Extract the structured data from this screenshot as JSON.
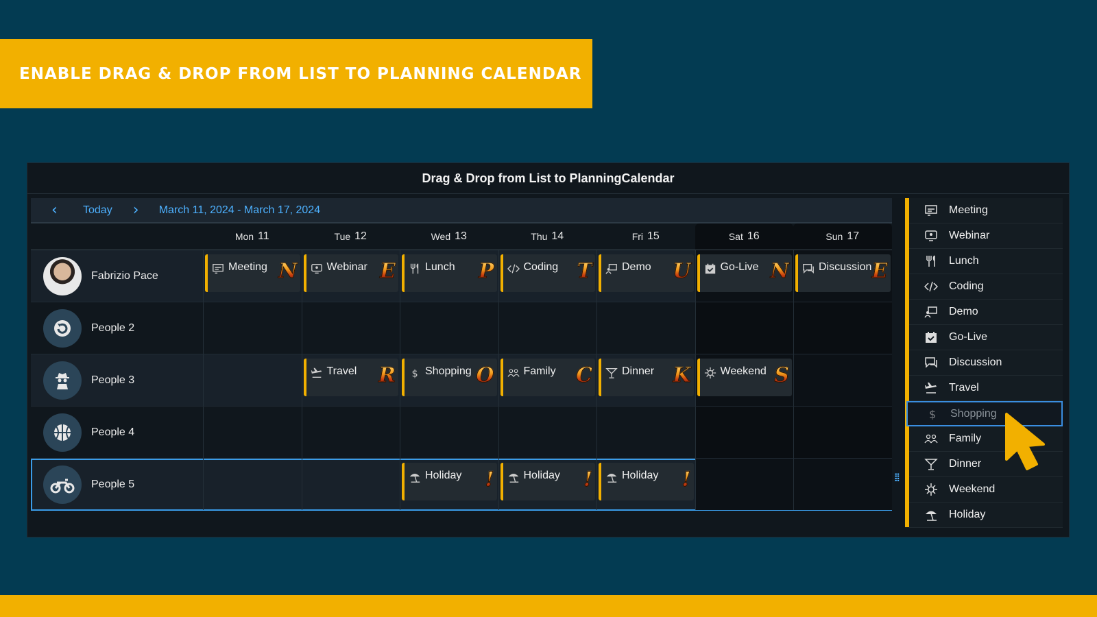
{
  "banner": {
    "text": "ENABLE DRAG & DROP FROM LIST TO PLANNING CALENDAR"
  },
  "app": {
    "title": "Drag & Drop from List to PlanningCalendar"
  },
  "toolbar": {
    "prev_icon": "chevron-left-icon",
    "today_label": "Today",
    "next_icon": "chevron-right-icon",
    "date_range": "March 11, 2024 - March 17, 2024"
  },
  "days": [
    {
      "dow": "Mon",
      "num": "11"
    },
    {
      "dow": "Tue",
      "num": "12"
    },
    {
      "dow": "Wed",
      "num": "13"
    },
    {
      "dow": "Thu",
      "num": "14"
    },
    {
      "dow": "Fri",
      "num": "15"
    },
    {
      "dow": "Sat",
      "num": "16"
    },
    {
      "dow": "Sun",
      "num": "17"
    }
  ],
  "people": [
    {
      "name": "Fabrizio Pace",
      "avatar": "photo"
    },
    {
      "name": "People 2",
      "avatar": "refresh-icon"
    },
    {
      "name": "People 3",
      "avatar": "spy-icon"
    },
    {
      "name": "People 4",
      "avatar": "basketball-icon"
    },
    {
      "name": "People 5",
      "avatar": "motorcycle-icon"
    }
  ],
  "appointments": {
    "row0": [
      {
        "title": "Meeting",
        "icon": "meeting-icon",
        "letter": "N"
      },
      {
        "title": "Webinar",
        "icon": "webinar-icon",
        "letter": "E"
      },
      {
        "title": "Lunch",
        "icon": "lunch-icon",
        "letter": "P"
      },
      {
        "title": "Coding",
        "icon": "coding-icon",
        "letter": "T"
      },
      {
        "title": "Demo",
        "icon": "demo-icon",
        "letter": "U"
      },
      {
        "title": "Go-Live",
        "icon": "go-live-icon",
        "letter": "N"
      },
      {
        "title": "Discussion",
        "icon": "discussion-icon",
        "letter": "E"
      }
    ],
    "row2": [
      {
        "title": "Travel",
        "icon": "travel-icon",
        "letter": "R"
      },
      {
        "title": "Shopping",
        "icon": "shopping-icon",
        "letter": "O"
      },
      {
        "title": "Family",
        "icon": "family-icon",
        "letter": "C"
      },
      {
        "title": "Dinner",
        "icon": "dinner-icon",
        "letter": "K"
      },
      {
        "title": "Weekend",
        "icon": "weekend-icon",
        "letter": "S"
      }
    ],
    "row4": [
      {
        "title": "Holiday",
        "icon": "holiday-icon",
        "letter": "!"
      },
      {
        "title": "Holiday",
        "icon": "holiday-icon",
        "letter": "!"
      },
      {
        "title": "Holiday",
        "icon": "holiday-icon",
        "letter": "!"
      }
    ]
  },
  "list": {
    "items": [
      {
        "label": "Meeting",
        "icon": "meeting-icon"
      },
      {
        "label": "Webinar",
        "icon": "webinar-icon"
      },
      {
        "label": "Lunch",
        "icon": "lunch-icon"
      },
      {
        "label": "Coding",
        "icon": "coding-icon"
      },
      {
        "label": "Demo",
        "icon": "demo-icon"
      },
      {
        "label": "Go-Live",
        "icon": "go-live-icon"
      },
      {
        "label": "Discussion",
        "icon": "discussion-icon"
      },
      {
        "label": "Travel",
        "icon": "travel-icon"
      },
      {
        "label": "Shopping",
        "icon": "shopping-icon",
        "state": "dragging"
      },
      {
        "label": "Family",
        "icon": "family-icon"
      },
      {
        "label": "Dinner",
        "icon": "dinner-icon"
      },
      {
        "label": "Weekend",
        "icon": "weekend-icon"
      },
      {
        "label": "Holiday",
        "icon": "holiday-icon"
      }
    ]
  },
  "colors": {
    "accent": "#f2b000",
    "link": "#4db1ff",
    "background": "#033b52",
    "panel": "#10171d"
  }
}
